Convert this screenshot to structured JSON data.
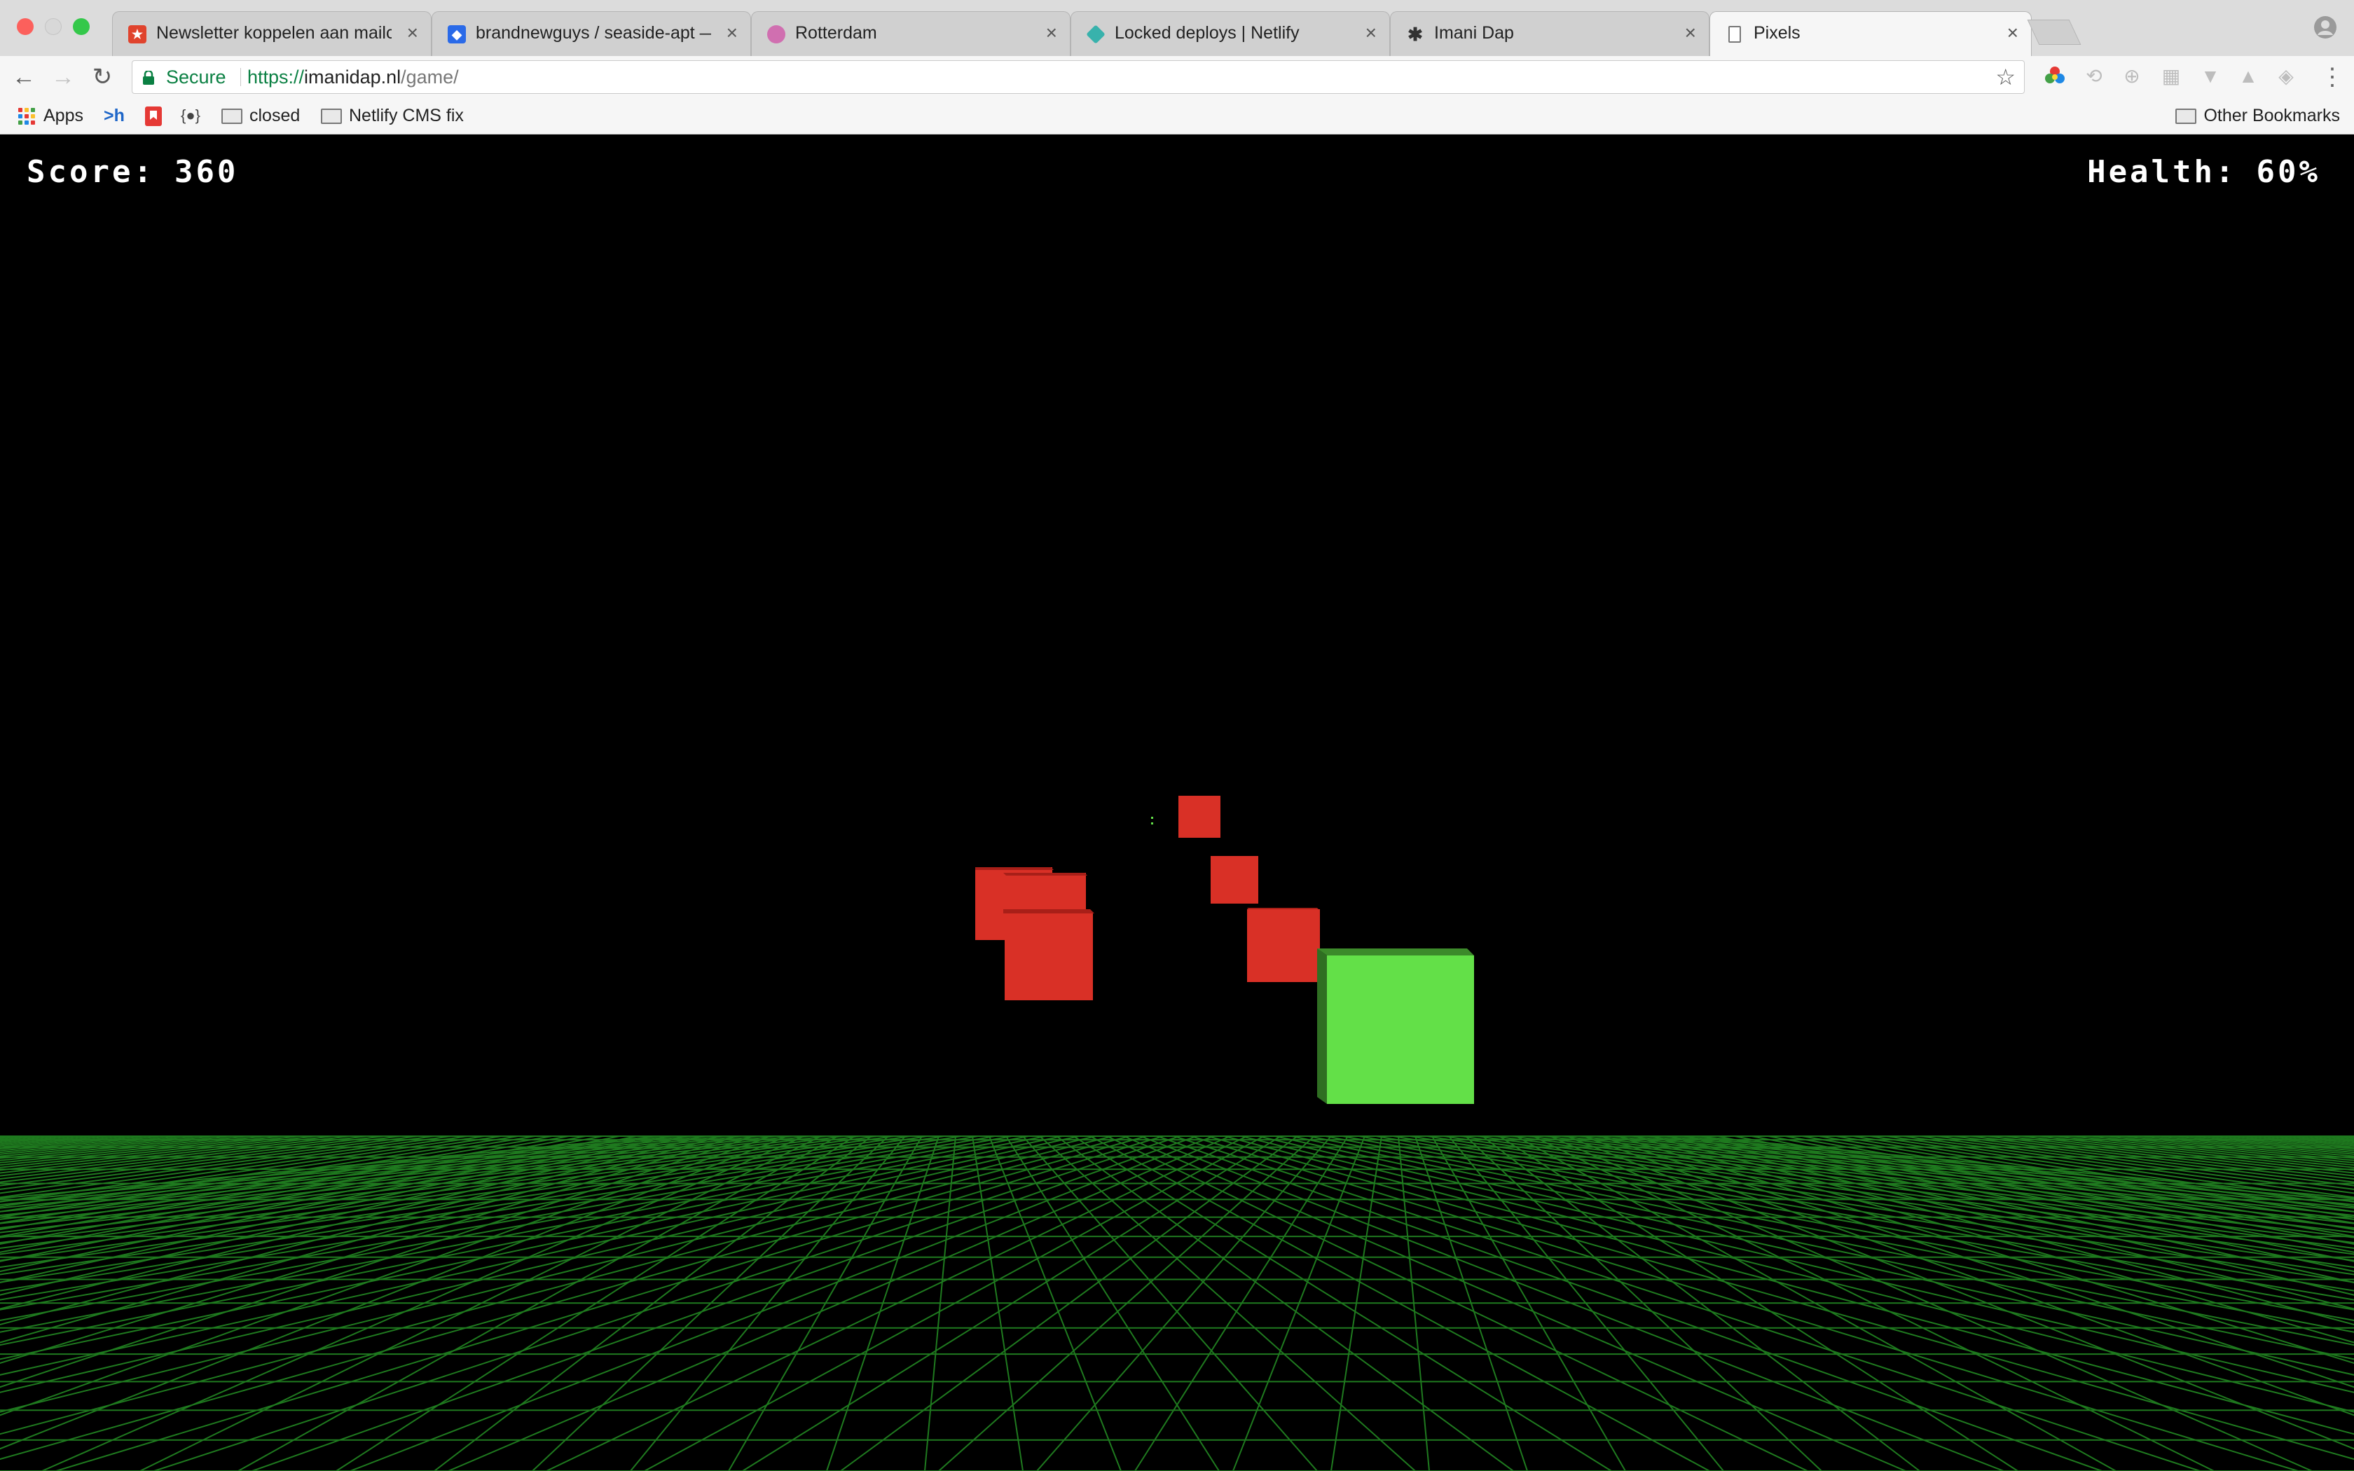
{
  "tabs": [
    {
      "title": "Newsletter koppelen aan mailc",
      "favicon_color": "#e0432d",
      "favicon_glyph": "★",
      "active": false
    },
    {
      "title": "brandnewguys / seaside-apt —",
      "favicon_color": "#2a6ae8",
      "favicon_glyph": "◆",
      "active": false
    },
    {
      "title": "Rotterdam",
      "favicon_color": "#d06fb0",
      "favicon_glyph": "●",
      "active": false
    },
    {
      "title": "Locked deploys | Netlify",
      "favicon_color": "#38b2ac",
      "favicon_glyph": "◈",
      "active": false
    },
    {
      "title": "Imani Dap",
      "favicon_color": "#333333",
      "favicon_glyph": "✱",
      "active": false
    },
    {
      "title": "Pixels",
      "favicon_color": "#ffffff",
      "favicon_glyph": "🗋",
      "active": true
    }
  ],
  "toolbar": {
    "secure_label": "Secure",
    "url_scheme": "https://",
    "url_host": "imanidap.nl",
    "url_path": "/game/"
  },
  "bookmarks": {
    "apps": "Apps",
    "item2": ">h",
    "folder_closed": "closed",
    "folder_netlify": "Netlify CMS fix",
    "other": "Other Bookmarks"
  },
  "hud": {
    "score_label": "Score:",
    "score_value": "360",
    "health_label": "Health:",
    "health_value": "60%"
  },
  "colors": {
    "enemy_cube": "#d93026",
    "player_cube": "#63e048",
    "grid_line": "#1f7a1f",
    "secure_green": "#0b8043"
  }
}
